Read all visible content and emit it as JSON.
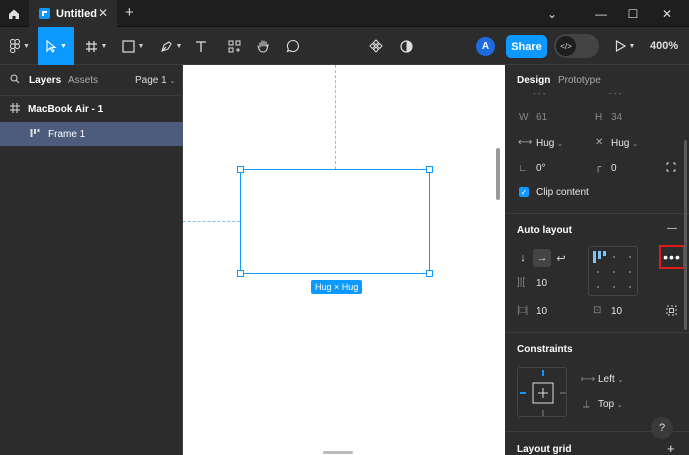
{
  "titlebar": {
    "tab_title": "Untitled",
    "tab_close": "✕",
    "new_tab": "+",
    "win_chevron": "⌄",
    "win_minimize": "—",
    "win_maximize": "☐",
    "win_close": "✕"
  },
  "toolbar": {
    "avatar_initial": "A",
    "share_label": "Share",
    "dev_mode": "</>",
    "zoom": "400%"
  },
  "left_panel": {
    "tab_layers": "Layers",
    "tab_assets": "Assets",
    "page_selector": "Page 1",
    "layers": [
      {
        "name": "MacBook Air - 1"
      },
      {
        "name": "Frame 1"
      }
    ]
  },
  "canvas": {
    "size_label": "Hug × Hug"
  },
  "right_panel": {
    "tab_design": "Design",
    "tab_prototype": "Prototype",
    "position_partial_x": "- - -",
    "position_partial_y": "- - -",
    "w_label": "W",
    "w_value": "61",
    "h_label": "H",
    "h_value": "34",
    "hug_w": "Hug",
    "hug_h": "Hug",
    "rotation": "0°",
    "radius": "0",
    "clip_content": "Clip content",
    "auto_layout": {
      "title": "Auto layout",
      "collapse": "—",
      "gap": "10",
      "padding_h": "10",
      "padding_v": "10",
      "more": "•••"
    },
    "constraints": {
      "title": "Constraints",
      "horizontal": "Left",
      "vertical": "Top"
    },
    "layout_grid": {
      "title": "Layout grid",
      "add": "+"
    },
    "help": "?"
  },
  "colors": {
    "accent": "#0d99ff",
    "highlight": "#e01b1b",
    "panel_bg": "#2c2c2c",
    "selected_layer": "#4d5c7d"
  }
}
